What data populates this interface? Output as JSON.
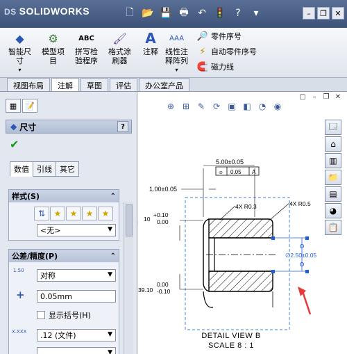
{
  "app": {
    "logo_prefix": "DS",
    "logo_text": "SOLIDWORKS"
  },
  "quick_access": [
    "new-icon",
    "open-icon",
    "save-icon",
    "print-icon",
    "undo-icon",
    "rebuild-icon",
    "help-icon",
    "options-icon"
  ],
  "window_controls": [
    "minimize",
    "restore",
    "close"
  ],
  "ribbon": {
    "smart_dimension": "智能尺\n寸",
    "model_items": "模型项\n目",
    "spell_check": "拼写检\n验程序",
    "format_painter": "格式涂\n刷器",
    "note": "注释",
    "linear_pattern": "线性注\n释阵列",
    "balloon": "零件序号",
    "auto_balloon": "自动零件序号",
    "magnetic_line": "磁力线"
  },
  "tabs": [
    {
      "label": "视图布局",
      "active": false
    },
    {
      "label": "注解",
      "active": true
    },
    {
      "label": "草图",
      "active": false
    },
    {
      "label": "评估",
      "active": false
    },
    {
      "label": "办公室产品",
      "active": false
    }
  ],
  "panel": {
    "title": "尺寸",
    "help": "?",
    "subtabs": [
      {
        "label": "数值",
        "active": true
      },
      {
        "label": "引线",
        "active": false
      },
      {
        "label": "其它",
        "active": false
      }
    ],
    "style_group": {
      "title": "样式(S)",
      "select_value": "<无>"
    },
    "tolerance_group": {
      "title": "公差/精度(P)",
      "tol_icon_text": "1.50",
      "tol_type": "对称",
      "value": "0.05mm",
      "show_parens": "显示括号(H)",
      "precision_icon_text": "X.XXX",
      "precision": ".12 (文件)"
    }
  },
  "drawing": {
    "dim_top": "5.00±0.05",
    "fcf_symbol": "⌯",
    "fcf_value": "0.05",
    "fcf_datum": "A",
    "dim_left": "1.00±0.05",
    "tol_plus_a": "+0.10",
    "tol_plus_b": "0.00",
    "tol_left_value": "10",
    "tol_minus_a": "0.00",
    "tol_minus_b": "-0.10",
    "tol_left_value2": "39.10",
    "radius_1": "4X R0.3",
    "radius_2": "4X R0.5",
    "dia_dim": "∅2.50±0.05",
    "caption_1": "DETAIL VIEW B",
    "caption_2": "SCALE 8 : 1"
  },
  "colors": {
    "accent": "#3d5279",
    "selection": "#1f5fd6",
    "arrow": "#e8393a"
  }
}
